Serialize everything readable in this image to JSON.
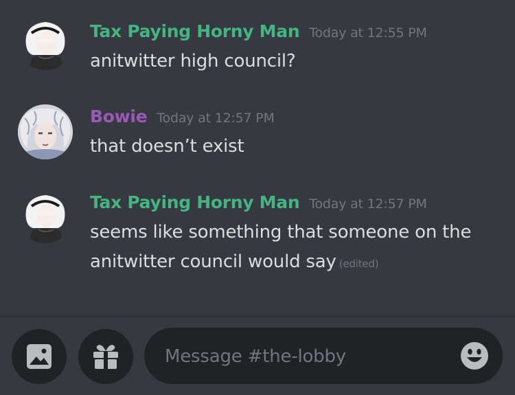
{
  "channel": "the-lobby",
  "messages": [
    {
      "author": "Tax Paying Horny Man",
      "author_color": "#43b581",
      "timestamp": "Today at 12:55 PM",
      "text": "anitwitter high council?",
      "avatar": "white-haired-character-avatar"
    },
    {
      "author": "Bowie",
      "author_color": "#9b59b6",
      "timestamp": "Today at 12:57 PM",
      "text": "that doesn’t exist",
      "avatar": "anime-portrait-avatar"
    },
    {
      "author": "Tax Paying Horny Man",
      "author_color": "#43b581",
      "timestamp": "Today at 12:57 PM",
      "text_line1": "seems like something that someone on the",
      "text_line2": "anitwitter council would say",
      "edited_label": "(edited)",
      "avatar": "white-haired-character-avatar"
    }
  ],
  "composer": {
    "placeholder": "Message #the-lobby",
    "buttons": [
      "image-icon",
      "gift-icon",
      "emoji-icon"
    ]
  },
  "colors": {
    "background": "#36393f",
    "input_background": "#202225",
    "muted_text": "#72767d",
    "body_text": "#dcddde",
    "icon": "#b9bbbe"
  }
}
